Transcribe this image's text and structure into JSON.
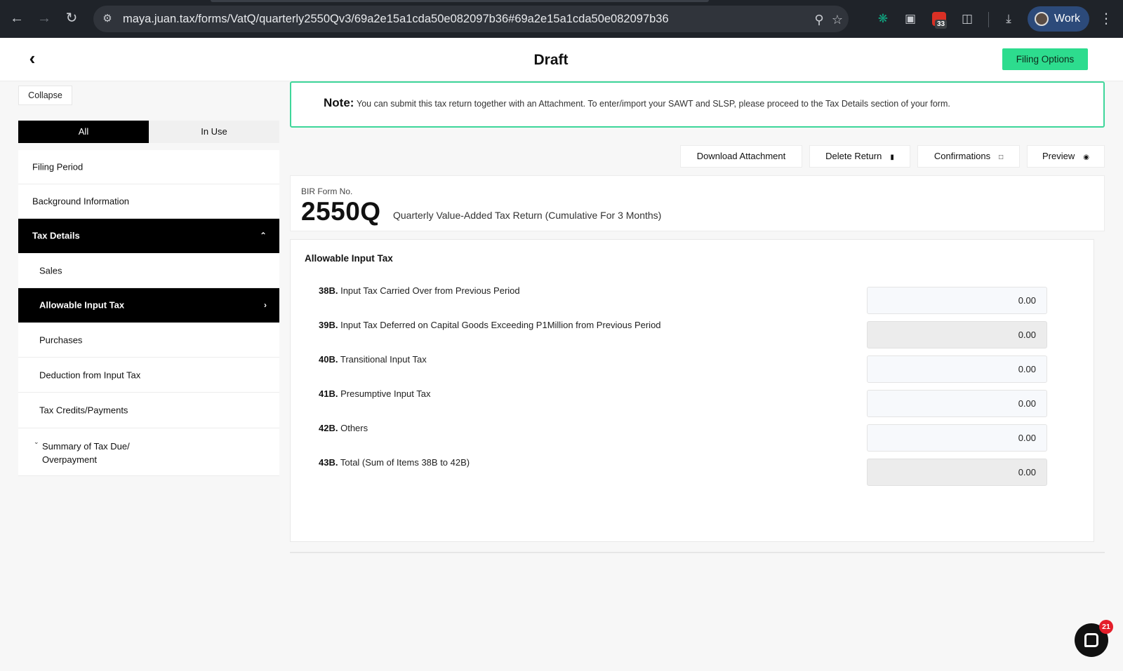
{
  "browser": {
    "url": "maya.juan.tax/forms/VatQ/quarterly2550Qv3/69a2e15a1cda50e082097b36#69a2e15a1cda50e082097b36",
    "calendar_badge": "33",
    "profile_label": "Work"
  },
  "header": {
    "title": "Draft",
    "filing_options_label": "Filing Options"
  },
  "sidebar": {
    "collapse_label": "Collapse",
    "tabs": [
      {
        "label": "All",
        "active": true
      },
      {
        "label": "In Use",
        "active": false
      }
    ],
    "items": [
      {
        "label": "Filing Period"
      },
      {
        "label": "Background Information"
      },
      {
        "label": "Tax Details",
        "expanded": true
      },
      {
        "label": "Sales"
      },
      {
        "label": "Allowable Input Tax",
        "active": true
      },
      {
        "label": "Purchases"
      },
      {
        "label": "Deduction from Input Tax"
      },
      {
        "label": "Tax Credits/Payments"
      }
    ],
    "summary_line1": "Summary of Tax Due/",
    "summary_line2": "Overpayment"
  },
  "note": {
    "label": "Note:",
    "text": "You can submit this tax return together with an Attachment. To enter/import your SAWT and SLSP, please proceed to the Tax Details section of your form."
  },
  "actions": {
    "download_attachment": "Download Attachment",
    "delete_return": "Delete Return",
    "confirmations": "Confirmations",
    "preview": "Preview"
  },
  "form": {
    "number_label": "BIR Form No.",
    "number": "2550Q",
    "description": "Quarterly Value-Added Tax Return (Cumulative For 3 Months)"
  },
  "section": {
    "title": "Allowable Input Tax",
    "rows": [
      {
        "code": "38B.",
        "label": "Input Tax Carried Over from Previous Period",
        "value": "0.00",
        "readonly": false
      },
      {
        "code": "39B.",
        "label": "Input Tax Deferred on Capital Goods Exceeding P1Million from Previous Period",
        "value": "0.00",
        "readonly": true
      },
      {
        "code": "40B.",
        "label": "Transitional Input Tax",
        "value": "0.00",
        "readonly": false
      },
      {
        "code": "41B.",
        "label": "Presumptive Input Tax",
        "value": "0.00",
        "readonly": false
      },
      {
        "code": "42B.",
        "label": "Others",
        "value": "0.00",
        "readonly": false
      },
      {
        "code": "43B.",
        "label": "Total (Sum of Items 38B to 42B)",
        "value": "0.00",
        "readonly": true
      }
    ]
  },
  "chat": {
    "badge": "21"
  },
  "colors": {
    "accent_green": "#2ddc8e",
    "note_border": "#3ed69a",
    "active_nav": "#000000"
  }
}
